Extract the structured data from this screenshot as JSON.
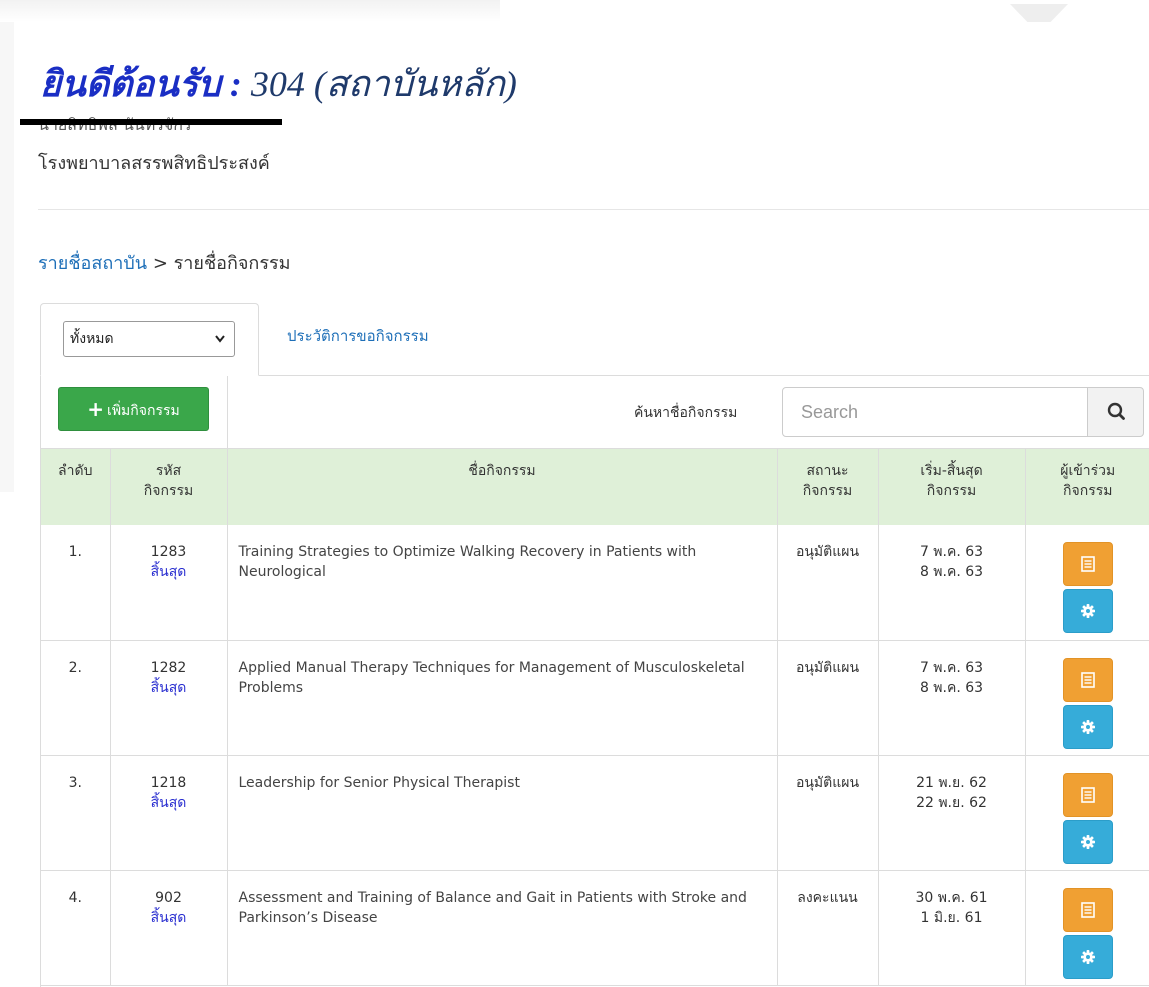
{
  "header": {
    "welcome_label": "ยินดีต้อนรับ :",
    "institution": "304 (สถาบันหลัก)",
    "person_name": "นายสิทธิพล นันทรจักร",
    "hospital": "โรงพยาบาลสรรพสิทธิประสงค์"
  },
  "breadcrumb": {
    "link": "รายชื่อสถาบัน",
    "separator": ">",
    "current": "รายชื่อกิจกรรม"
  },
  "tabs": {
    "filter_value": "ทั้งหมด",
    "history_label": "ประวัติการขอกิจกรรม"
  },
  "toolbar": {
    "add_label": "เพิ่มกิจกรรม",
    "search_label": "ค้นหาชื่อกิจกรรม",
    "search_placeholder": "Search"
  },
  "table": {
    "headers": {
      "no": "ลำดับ",
      "code_1": "รหัส",
      "code_2": "กิจกรรม",
      "name": "ชื่อกิจกรรม",
      "status_1": "สถานะ",
      "status_2": "กิจกรรม",
      "date_1": "เริ่ม-สิ้นสุด",
      "date_2": "กิจกรรม",
      "participants_1": "ผู้เข้าร่วม",
      "participants_2": "กิจกรรม"
    },
    "rows": [
      {
        "no": "1.",
        "code": "1283",
        "code_status": "สิ้นสุด",
        "name": "Training Strategies to Optimize Walking Recovery in Patients with Neurological",
        "status": "อนุมัติแผน",
        "start": "7 พ.ค. 63",
        "end": "8 พ.ค. 63"
      },
      {
        "no": "2.",
        "code": "1282",
        "code_status": "สิ้นสุด",
        "name": "Applied Manual Therapy Techniques for Management of Musculoskeletal Problems",
        "status": "อนุมัติแผน",
        "start": "7 พ.ค. 63",
        "end": "8 พ.ค. 63"
      },
      {
        "no": "3.",
        "code": "1218",
        "code_status": "สิ้นสุด",
        "name": "Leadership for Senior Physical Therapist",
        "status": "อนุมัติแผน",
        "start": "21 พ.ย. 62",
        "end": "22 พ.ย. 62"
      },
      {
        "no": "4.",
        "code": "902",
        "code_status": "สิ้นสุด",
        "name": "Assessment and Training of Balance and Gait in Patients with Stroke and Parkinson’s Disease",
        "status": "ลงคะแนน",
        "start": "30 พ.ค. 61",
        "end": "1 มิ.ย. 61"
      }
    ]
  },
  "colors": {
    "add_button": "#3aa74a",
    "header_row": "#dff0d8",
    "list_button": "#f0a033",
    "settings_button": "#36acd9",
    "link": "#1e6fb8"
  },
  "icons": {
    "add": "plus-icon",
    "search": "search-icon",
    "dropdown": "chevron-down-icon",
    "list": "list-icon",
    "settings": "gear-icon"
  }
}
